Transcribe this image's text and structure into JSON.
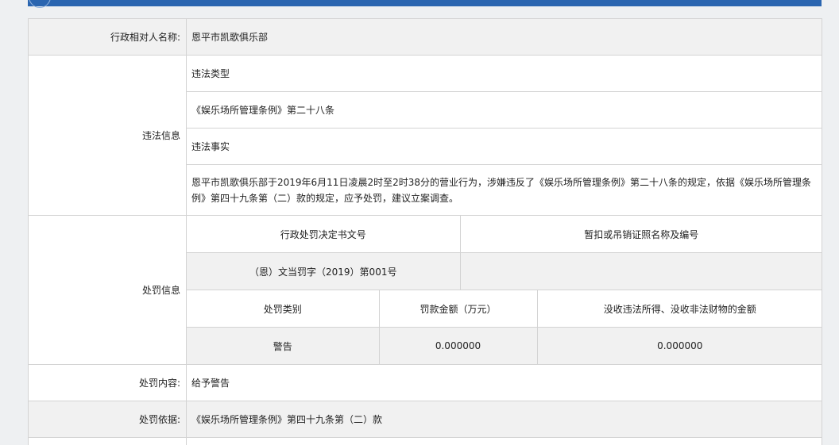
{
  "target": {
    "label": "行政相对人名称:",
    "value": "恩平市凯歌俱乐部"
  },
  "violation": {
    "label": "违法信息",
    "type_heading": "违法类型",
    "type_value": "《娱乐场所管理条例》第二十八条",
    "fact_heading": "违法事实",
    "fact_value": "恩平市凯歌俱乐部于2019年6月11日凌晨2时至2时38分的营业行为，涉嫌违反了《娱乐场所管理条例》第二十八条的规定，依据《娱乐场所管理条例》第四十九条第（二）款的规定，应予处罚，建议立案调查。"
  },
  "penalty": {
    "label": "处罚信息",
    "doc_no_header": "行政处罚决定书文号",
    "license_header": "暂扣或吊销证照名称及编号",
    "doc_no_value": "（恩）文当罚字（2019）第001号",
    "license_value": "",
    "category_header": "处罚类别",
    "fine_header": "罚款金额（万元）",
    "confiscation_header": "没收违法所得、没收非法财物的金额",
    "category_value": "警告",
    "fine_value": "0.000000",
    "confiscation_value": "0.000000"
  },
  "content": {
    "label": "处罚内容:",
    "value": "给予警告"
  },
  "basis": {
    "label": "处罚依据:",
    "value": "《娱乐场所管理条例》第四十九条第（二）款"
  },
  "colors": {
    "header_bar": "#2a65b0",
    "gray_row": "#f1f1f1",
    "border": "#d3d3d3"
  }
}
